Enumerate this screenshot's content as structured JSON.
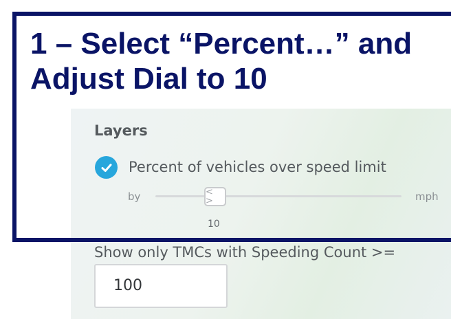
{
  "overlay": {
    "title_line1": "1 – Select “Percent…” and",
    "title_line2": "Adjust Dial to 10",
    "frame_color": "#0a1466"
  },
  "layers_panel": {
    "header": "Layers",
    "layer": {
      "label": "Percent of vehicles over speed limit",
      "checked": true,
      "check_icon": "checkmark-icon",
      "accent_color": "#27a6dc"
    },
    "slider": {
      "prefix": "by",
      "suffix": "mph",
      "value": "10",
      "handle_glyph": "< >"
    },
    "filter": {
      "label": "Show only TMCs with Speeding Count >=",
      "value": "100"
    }
  }
}
